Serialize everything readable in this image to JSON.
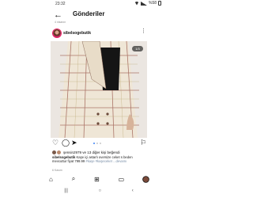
{
  "status_bar": {
    "time": "23:32",
    "battery": "%58"
  },
  "header": {
    "back_icon": "back-arrow-icon",
    "title": "Gönderiler",
    "subtitle": "4 nisanın"
  },
  "post": {
    "username": "sibelsogebutik",
    "image_counter": "1/3",
    "likes_text": "şensin2979 ve 13 diğer kişi beğendi",
    "caption": {
      "username": "sibelsogebutik",
      "text": "Kaşe içi astarlı oversize ceket s beden mevcuttur fiyat 799.99",
      "tags": "#kaşe #kaşeceket ...devamı"
    },
    "date": "6 Kasım"
  },
  "icons": {
    "like": "heart-icon",
    "comment": "comment-icon",
    "share": "share-icon",
    "bookmark": "bookmark-icon",
    "more": "more-vertical-icon"
  },
  "carousel": {
    "count": 3,
    "active": 0
  },
  "colors": {
    "accent": "#3b82f6",
    "avatar_ring": "#e91e63"
  },
  "bottom_nav": [
    "home-icon",
    "search-icon",
    "add-post-icon",
    "shop-icon",
    "profile-avatar"
  ],
  "system_nav": [
    "recent-apps-icon",
    "home-circle-icon",
    "back-chevron-icon"
  ]
}
